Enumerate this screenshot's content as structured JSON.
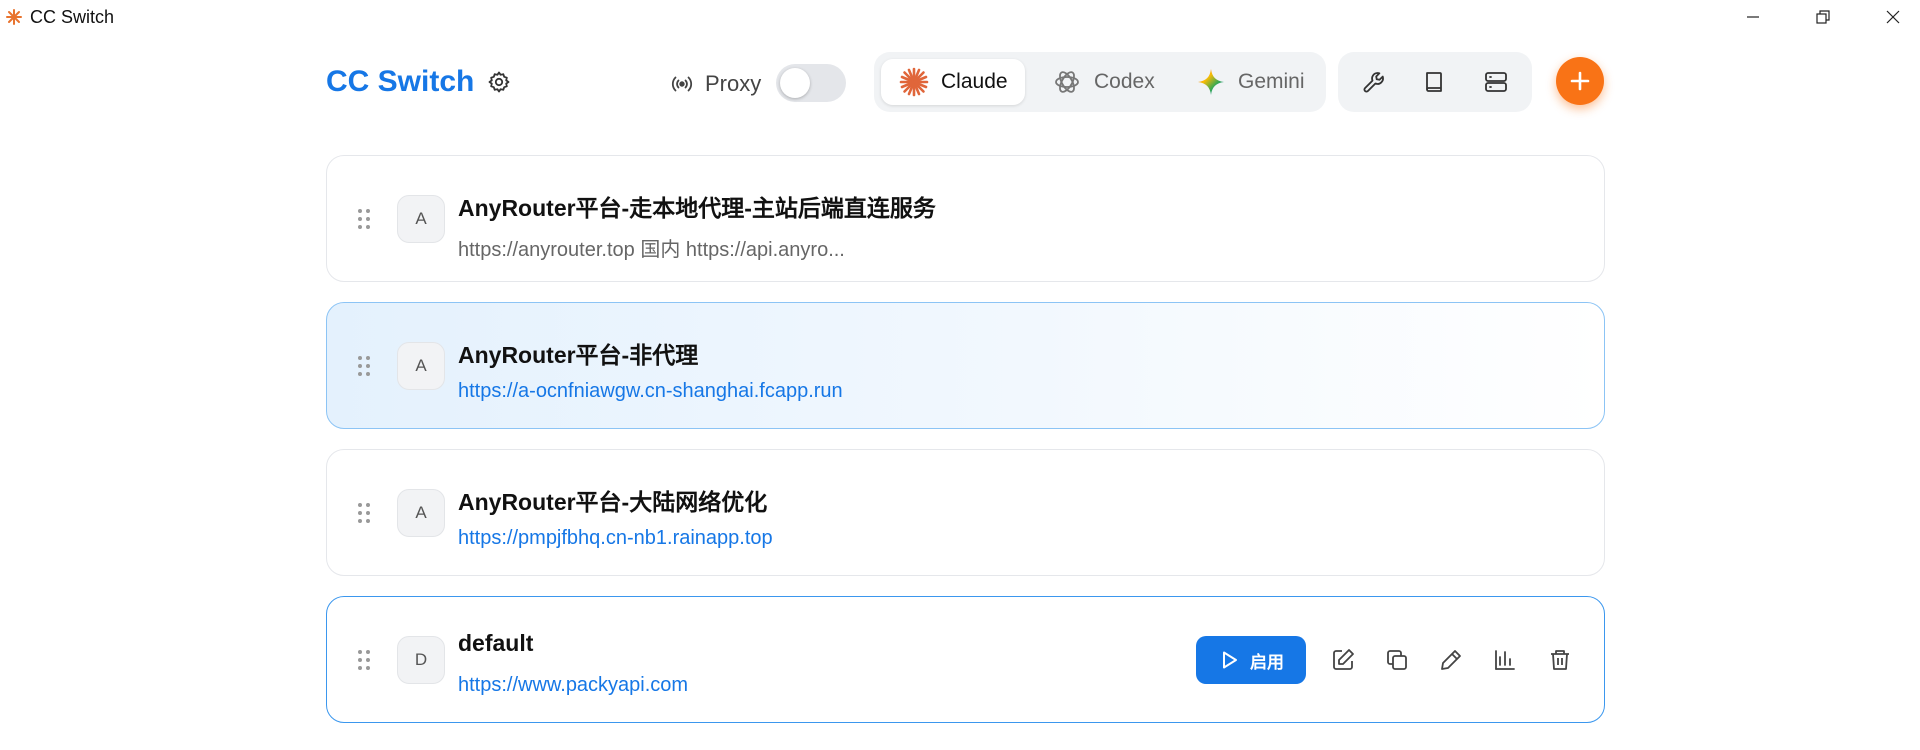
{
  "window": {
    "title": "CC Switch"
  },
  "header": {
    "brand": "CC Switch",
    "proxy_label": "Proxy",
    "proxy_enabled": false,
    "tabs": [
      {
        "label": "Claude",
        "icon": "claude-starburst-icon",
        "active": true
      },
      {
        "label": "Codex",
        "icon": "openai-icon",
        "active": false
      },
      {
        "label": "Gemini",
        "icon": "gemini-sparkle-icon",
        "active": false
      }
    ],
    "tools": [
      "wrench-icon",
      "book-icon",
      "server-icon"
    ],
    "accent": "#1677e6",
    "add_color": "#f97316"
  },
  "providers": [
    {
      "avatar": "A",
      "name": "AnyRouter平台-走本地代理-主站后端直连服务",
      "url": "https://anyrouter.top 国内 https://api.anyro..."
    },
    {
      "avatar": "A",
      "name": "AnyRouter平台-非代理",
      "url": "https://a-ocnfniawgw.cn-shanghai.fcapp.run"
    },
    {
      "avatar": "A",
      "name": "AnyRouter平台-大陆网络优化",
      "url": "https://pmpjfbhq.cn-nb1.rainapp.top"
    },
    {
      "avatar": "D",
      "name": "default",
      "url": "https://www.packyapi.com",
      "enable_label": "启用"
    }
  ]
}
